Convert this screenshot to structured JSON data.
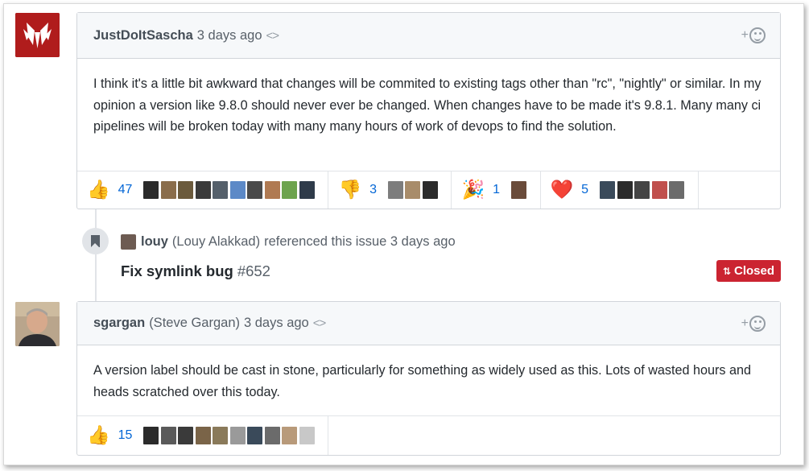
{
  "comments": [
    {
      "author": "JustDoItSascha",
      "fullname": "",
      "time": "3 days ago",
      "body": "I think it's a little bit awkward that changes will be commited to existing tags other than \"rc\", \"nightly\" or similar. In my opinion a version like 9.8.0 should never ever be changed. When changes have to be made it's 9.8.1. Many many ci pipelines will be broken today with many many hours of work of devops to find the solution.",
      "reactions": [
        {
          "emoji": "👍",
          "name": "thumbs-up",
          "count": "47",
          "users": 11
        },
        {
          "emoji": "👎",
          "name": "thumbs-down",
          "count": "3",
          "users": 3
        },
        {
          "emoji": "🎉",
          "name": "hooray",
          "count": "1",
          "users": 1
        },
        {
          "emoji": "❤️",
          "name": "heart",
          "count": "5",
          "users": 5
        }
      ]
    },
    {
      "author": "sgargan",
      "fullname": "(Steve Gargan)",
      "time": "3 days ago",
      "body": "A version label should be cast in stone, particularly for something as widely used as this. Lots of wasted hours and heads scratched over this today.",
      "reactions": [
        {
          "emoji": "👍",
          "name": "thumbs-up",
          "count": "15",
          "users": 10
        }
      ]
    }
  ],
  "code_icon": "<>",
  "add_reaction_plus": "+",
  "event": {
    "author": "louy",
    "fullname": "(Louy Alakkad)",
    "action": "referenced this issue 3 days ago",
    "ref_title": "Fix symlink bug",
    "ref_number": "#652",
    "state": "Closed"
  },
  "colors": {
    "closed": "#cb2431",
    "link": "#0366d6",
    "header_bg": "#f6f8fa",
    "border": "#d1d5da"
  },
  "icons": {
    "timeline_event": "bookmark-icon",
    "state": "git-pull-request-icon",
    "add_reaction": "smiley-icon",
    "header_action": "code-icon"
  }
}
